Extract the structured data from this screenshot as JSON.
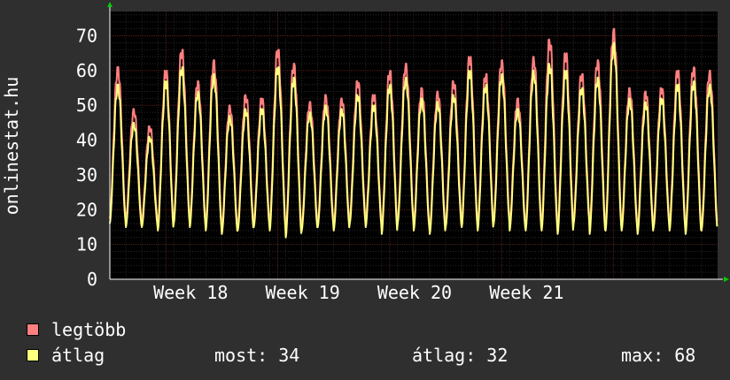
{
  "chart_data": {
    "type": "line",
    "ylabel": "onlinestat.hu",
    "yticks": [
      0,
      10,
      20,
      30,
      40,
      50,
      60,
      70
    ],
    "ylim": [
      0,
      77
    ],
    "week_ticks": [
      "Week 18",
      "Week 19",
      "Week 20",
      "Week 21"
    ],
    "grid": true,
    "series": [
      {
        "name": "legtöbb",
        "color": "#ff7f7f",
        "daily_peaks": [
          61,
          49,
          44,
          60,
          66,
          57,
          63,
          50,
          53,
          52,
          66,
          62,
          51,
          53,
          52,
          57,
          53,
          60,
          62,
          55,
          54,
          57,
          64,
          59,
          63,
          52,
          64,
          69,
          65,
          59,
          63,
          72,
          55,
          54,
          55,
          60,
          61,
          60
        ]
      },
      {
        "name": "átlag",
        "color": "#ffff7f",
        "daily_peaks": [
          56,
          45,
          41,
          57,
          61,
          54,
          59,
          47,
          49,
          49,
          61,
          58,
          48,
          50,
          49,
          53,
          50,
          56,
          58,
          52,
          51,
          53,
          60,
          56,
          59,
          49,
          60,
          62,
          60,
          55,
          58,
          68,
          52,
          51,
          52,
          56,
          57,
          56
        ]
      }
    ],
    "daily_min": [
      16,
      15,
      15,
      14,
      16,
      15,
      14,
      13,
      14,
      15,
      14,
      12,
      14,
      15,
      14,
      16,
      15,
      13,
      16,
      14,
      13,
      15,
      15,
      14,
      16,
      14,
      14,
      14,
      13,
      16,
      13,
      14,
      14,
      13,
      15,
      14,
      13,
      14
    ]
  },
  "legend": {
    "max_label": "legtöbb",
    "avg_label": "átlag",
    "most": "most: 34",
    "atlag": "átlag: 32",
    "max": "max: 68"
  }
}
